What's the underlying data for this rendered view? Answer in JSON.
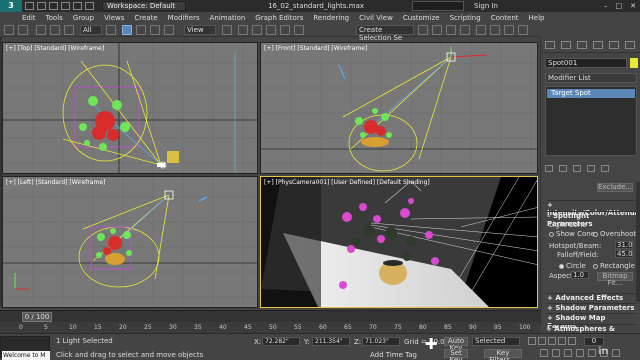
{
  "titlebar": {
    "app_logo": "3",
    "workspace": "Workspace: Default",
    "doc_title": "16_02_standard_lights.max",
    "sign_in": "Sign In"
  },
  "menu": [
    "Edit",
    "Tools",
    "Group",
    "Views",
    "Create",
    "Modifiers",
    "Animation",
    "Graph Editors",
    "Rendering",
    "Civil View",
    "Customize",
    "Scripting",
    "Content",
    "Help"
  ],
  "toolbar": {
    "view_dropdown": "View",
    "selection_set": "Create Selection Se"
  },
  "viewports": {
    "top": "[+] [Top] [Standard] [Wireframe]",
    "front": "[+] [Front] [Standard] [Wireframe]",
    "left": "[+] [Left] [Standard] [Wireframe]",
    "camera": "[+] [PhysCamera001] [User Defined] [Default Shading]"
  },
  "command_panel": {
    "object_name": "Spot001",
    "object_color": "#e8e83a",
    "modifier_list": "Modifier List",
    "stack_item": "Target Spot",
    "exclude_button": "Exclude...",
    "rollouts": {
      "intensity": "Intensity/Color/Attenuat",
      "spotlight": "Spotlight Parameters",
      "effects": "Advanced Effects",
      "shadow": "Shadow Parameters",
      "shadow_map": "Shadow Map Params",
      "atmospheres": "Atmospheres & Effects"
    },
    "light_cone": "Light Cone",
    "show_cone": "Show Cone",
    "overshoot": "Overshoot",
    "hotspot_label": "Hotspot/Beam:",
    "hotspot_value": "31.0",
    "falloff_label": "Falloff/Field:",
    "falloff_value": "45.0",
    "circle": "Circle",
    "rectangle": "Rectangle",
    "aspect_label": "Aspect:",
    "aspect_value": "1.0",
    "bitmap_fit": "Bitmap Fit..."
  },
  "timeline": {
    "slider": "0 / 100",
    "ticks": [
      "0",
      "5",
      "10",
      "15",
      "20",
      "25",
      "30",
      "35",
      "40",
      "45",
      "50",
      "55",
      "60",
      "65",
      "70",
      "75",
      "80",
      "85",
      "90",
      "95",
      "100"
    ]
  },
  "status": {
    "welcome": "Welcome to M",
    "selected": "1 Light Selected",
    "prompt": "Click and drag to select and move objects",
    "x_label": "X:",
    "x_value": "72.282\"",
    "y_label": "Y:",
    "y_value": "211.354\"",
    "z_label": "Z:",
    "z_value": "71.023\"",
    "grid": "Grid = 10.0\"",
    "add_time_tag": "Add Time Tag",
    "auto_key": "Auto Key",
    "set_key": "Set Key",
    "selected_dropdown": "Selected",
    "key_filters": "Key Filters...",
    "frame": "0"
  },
  "watermark": "linked in"
}
